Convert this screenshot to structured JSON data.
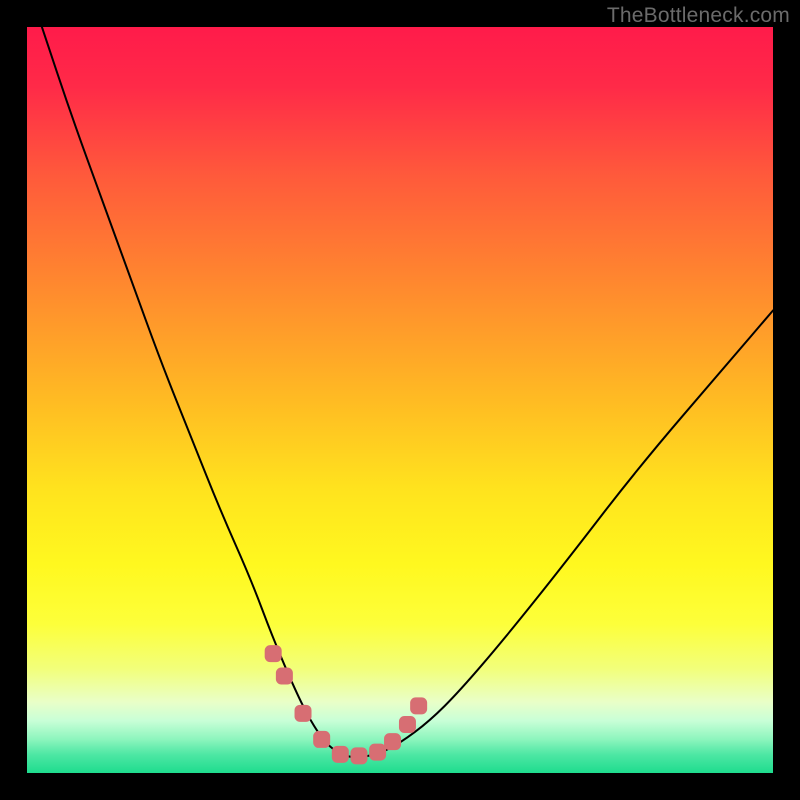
{
  "watermark": "TheBottleneck.com",
  "colors": {
    "black": "#000000",
    "curve": "#000000",
    "marker_fill": "#d76e73",
    "marker_stroke": "#d76e73",
    "watermark": "#6b6b6b"
  },
  "gradient_stops": [
    {
      "offset": 0.0,
      "color": "#ff1b4a"
    },
    {
      "offset": 0.08,
      "color": "#ff2a48"
    },
    {
      "offset": 0.2,
      "color": "#ff5a3b"
    },
    {
      "offset": 0.35,
      "color": "#ff8a2e"
    },
    {
      "offset": 0.5,
      "color": "#ffbb23"
    },
    {
      "offset": 0.62,
      "color": "#ffe31e"
    },
    {
      "offset": 0.72,
      "color": "#fff81f"
    },
    {
      "offset": 0.8,
      "color": "#fdff3a"
    },
    {
      "offset": 0.86,
      "color": "#f2ff7a"
    },
    {
      "offset": 0.905,
      "color": "#e9ffc8"
    },
    {
      "offset": 0.93,
      "color": "#c8ffd7"
    },
    {
      "offset": 0.955,
      "color": "#8cf5bd"
    },
    {
      "offset": 0.975,
      "color": "#4ee7a4"
    },
    {
      "offset": 1.0,
      "color": "#1edc8e"
    }
  ],
  "chart_data": {
    "type": "line",
    "title": "",
    "xlabel": "",
    "ylabel": "",
    "xlim": [
      0,
      100
    ],
    "ylim": [
      0,
      100
    ],
    "series": [
      {
        "name": "bottleneck-curve",
        "x": [
          2,
          6,
          10,
          14,
          18,
          22,
          26,
          30,
          33,
          36,
          38,
          40,
          42,
          44,
          47,
          50,
          54,
          58,
          64,
          72,
          82,
          94,
          100
        ],
        "y": [
          100,
          88,
          77,
          66,
          55,
          45,
          35,
          26,
          18,
          11,
          7,
          4,
          2.5,
          2,
          2.5,
          4,
          7,
          11,
          18,
          28,
          41,
          55,
          62
        ]
      }
    ],
    "markers": {
      "name": "highlight-points",
      "x": [
        33,
        34.5,
        37,
        39.5,
        42,
        44.5,
        47,
        49,
        51,
        52.5
      ],
      "y": [
        16,
        13,
        8,
        4.5,
        2.5,
        2.3,
        2.8,
        4.2,
        6.5,
        9
      ]
    }
  }
}
